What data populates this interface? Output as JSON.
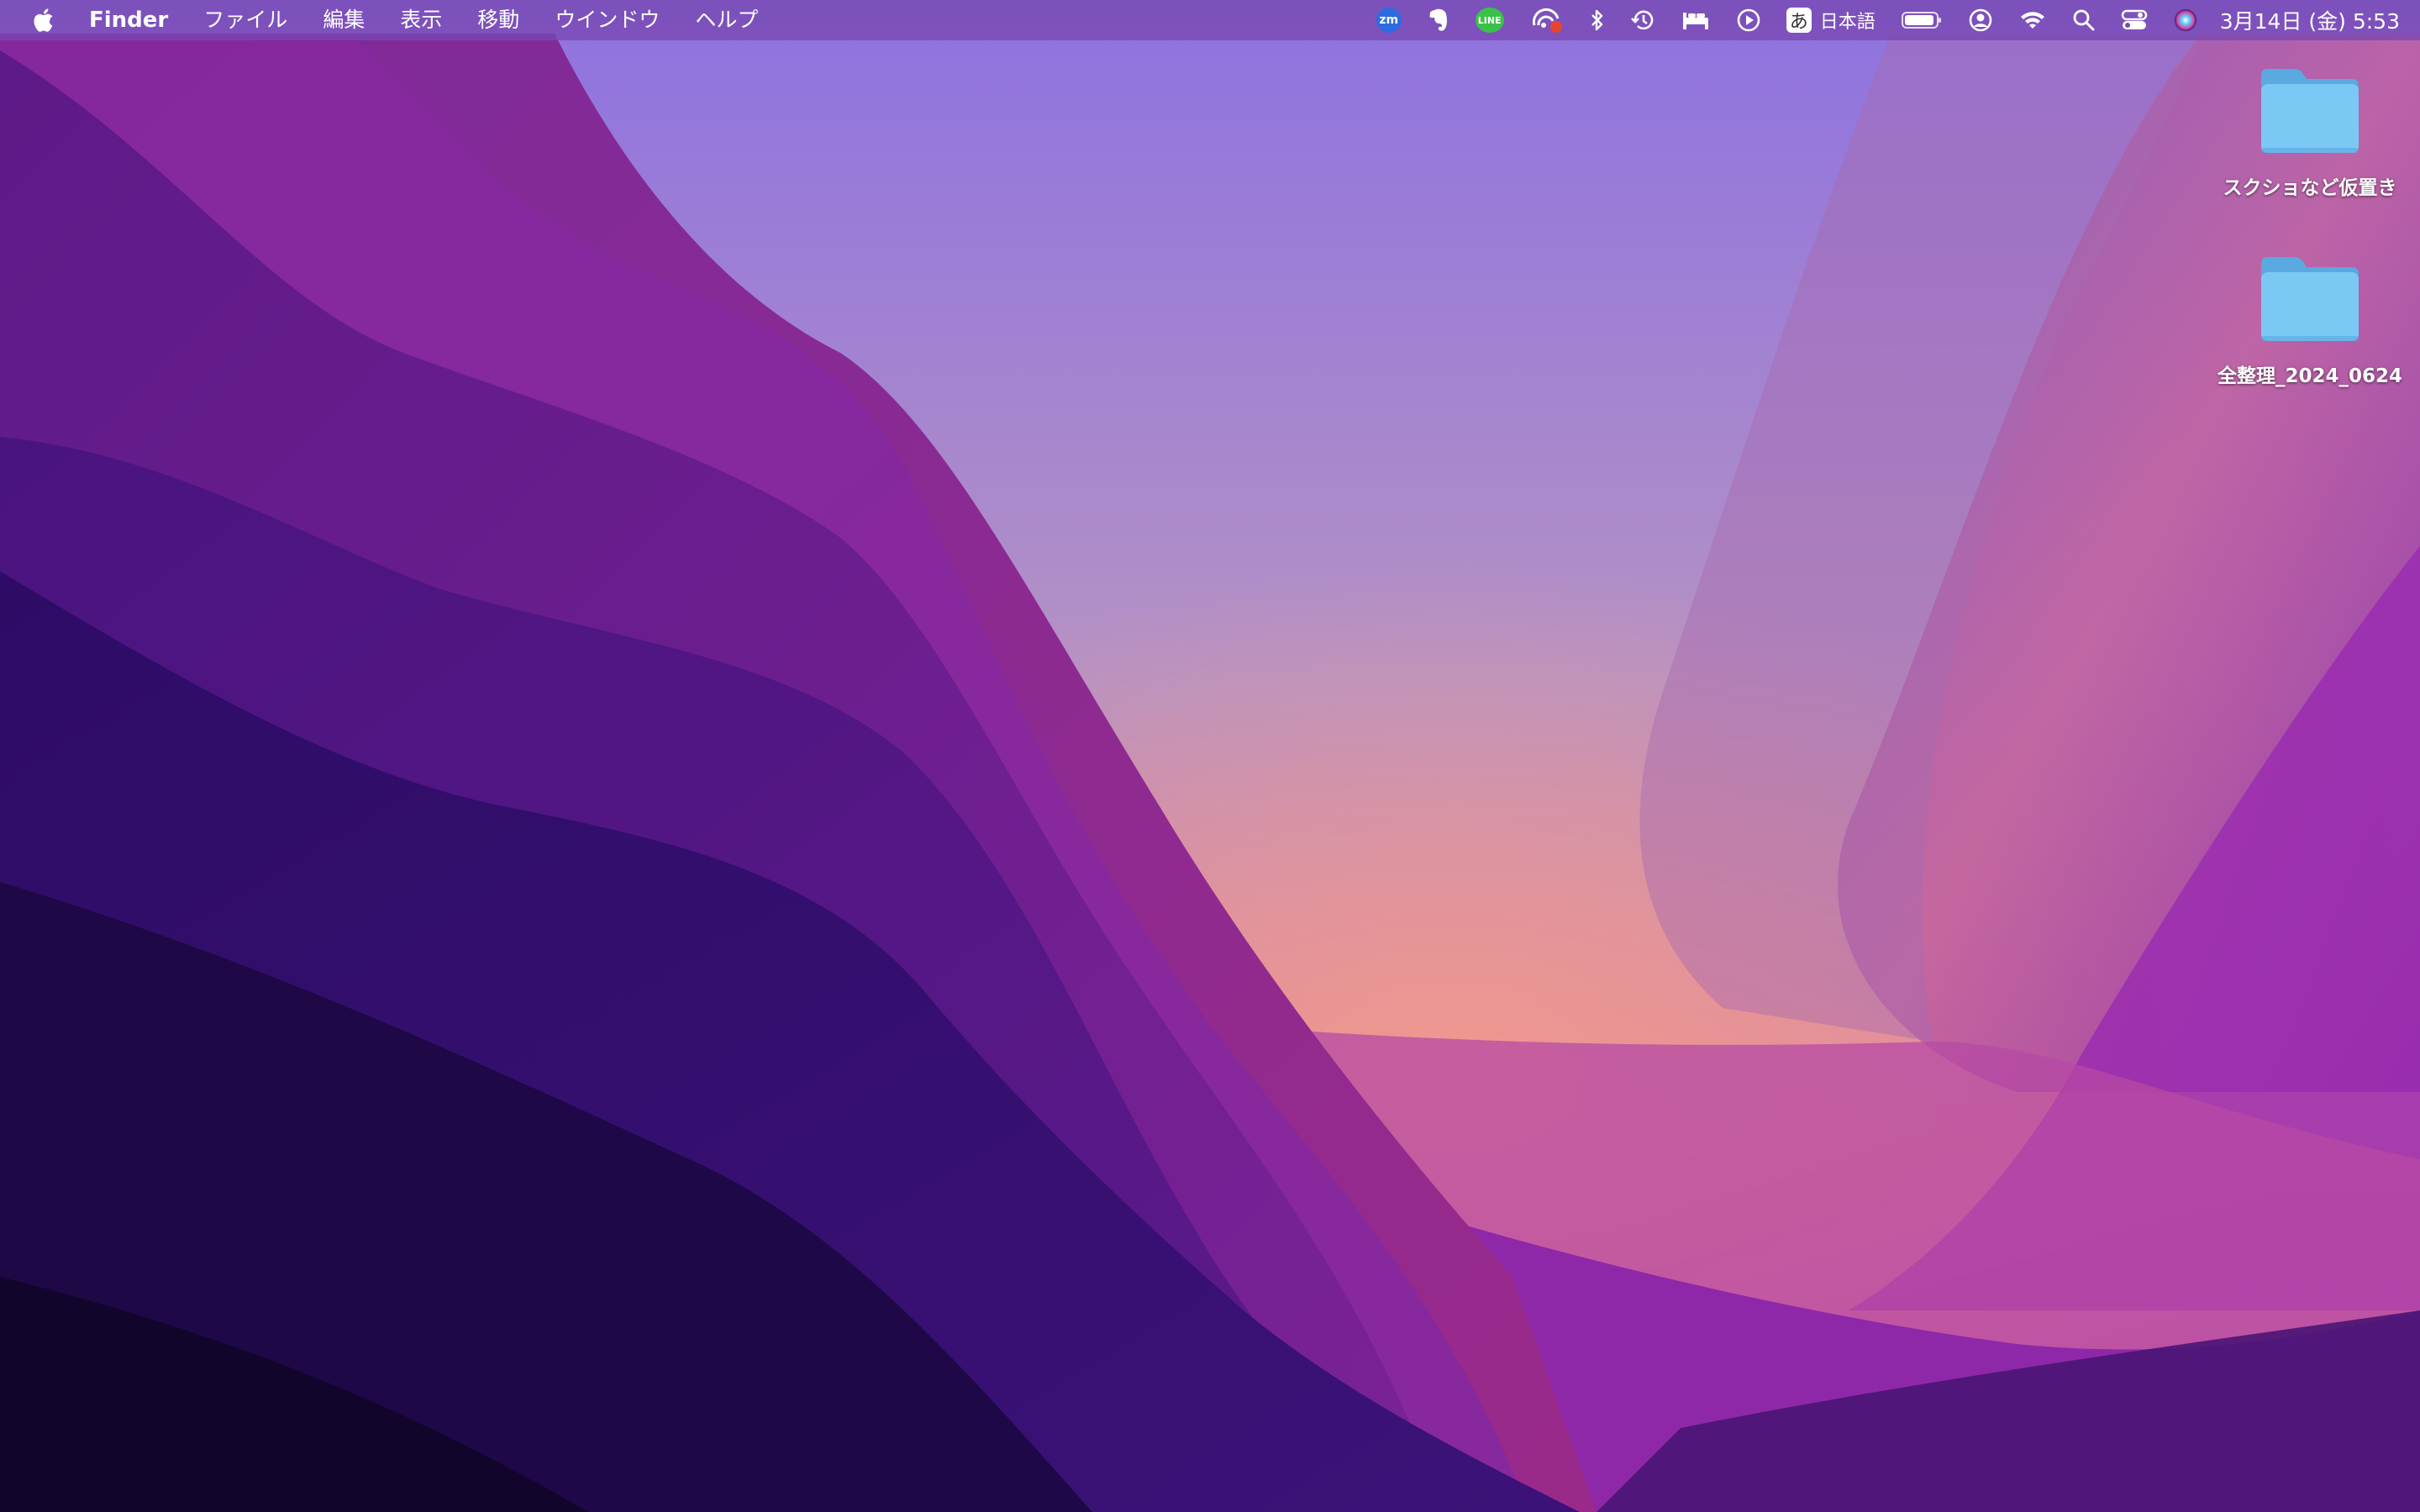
{
  "menubar": {
    "app_name": "Finder",
    "menus": [
      "ファイル",
      "編集",
      "表示",
      "移動",
      "ウインドウ",
      "ヘルプ"
    ],
    "status_items": {
      "zoom_label": "zm",
      "line_label": "LINE",
      "input_method_glyph": "あ",
      "input_method_label": "日本語"
    },
    "clock": "3月14日 (金)  5:53"
  },
  "desktop": {
    "icons": [
      {
        "label": "スクショなど仮置き",
        "type": "folder"
      },
      {
        "label": "全整理_2024_0624",
        "type": "folder"
      }
    ]
  },
  "colors": {
    "folder_body": "#7cc8f4",
    "folder_tab": "#5aa9e0",
    "menubar_bg": "#7848b2"
  }
}
